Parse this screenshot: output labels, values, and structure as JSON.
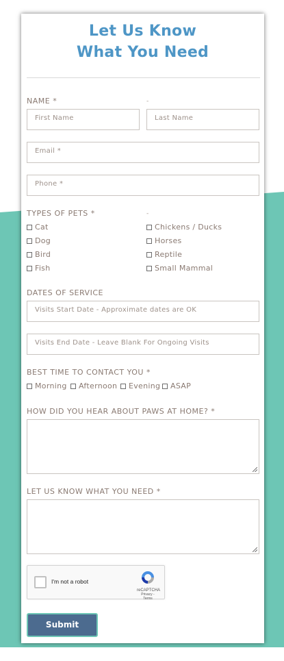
{
  "form": {
    "title_line1": "Let Us Know",
    "title_line2": "What You Need",
    "name_label": "NAME *",
    "name_dash": "-",
    "first_name_placeholder": "First Name",
    "last_name_placeholder": "Last Name",
    "email_placeholder": "Email *",
    "phone_placeholder": "Phone *",
    "pets_label": "TYPES OF PETS *",
    "pets_dash": "-",
    "pets_col1": [
      "Cat",
      "Dog",
      "Bird",
      "Fish"
    ],
    "pets_col2": [
      "Chickens / Ducks",
      "Horses",
      "Reptile",
      "Small Mammal"
    ],
    "dates_label": "DATES OF SERVICE",
    "start_date_placeholder": "Visits Start Date - Approximate dates are OK",
    "end_date_placeholder": "Visits End Date - Leave Blank For Ongoing Visits",
    "contact_label": "BEST TIME TO CONTACT YOU *",
    "contact_options": [
      "Morning",
      "Afternoon",
      "Evening",
      "ASAP"
    ],
    "hear_label": "HOW DID YOU HEAR ABOUT PAWS AT HOME? *",
    "need_label": "LET US KNOW WHAT YOU NEED *",
    "captcha_label": "I'm not a robot",
    "captcha_brand": "reCAPTCHA",
    "captcha_terms": "Privacy - Terms",
    "submit_label": "Submit"
  },
  "colors": {
    "title": "#4e96c6",
    "teal_background": "#6dc6b5",
    "submit_button": "#4c6b8f"
  }
}
